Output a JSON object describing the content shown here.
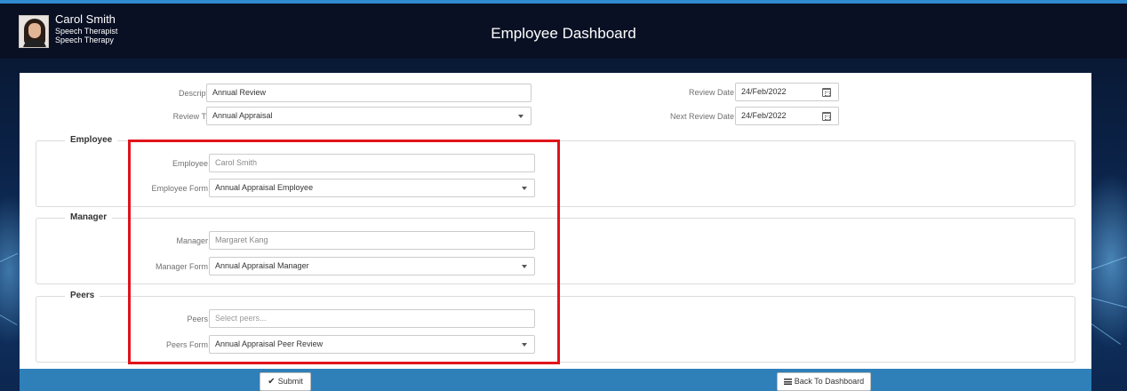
{
  "header": {
    "user": {
      "name": "Carol Smith",
      "role": "Speech Therapist",
      "department": "Speech Therapy"
    },
    "title": "Employee Dashboard"
  },
  "form": {
    "description": {
      "label": "Description *",
      "value": "Annual Review"
    },
    "review_type": {
      "label": "Review Type *",
      "value": "Annual Appraisal"
    },
    "review_date": {
      "label": "Review Date",
      "value": "24/Feb/2022"
    },
    "next_review_date": {
      "label": "Next Review Date",
      "value": "24/Feb/2022"
    },
    "employee_section": {
      "legend": "Employee",
      "employee": {
        "label": "Employee",
        "value": "Carol Smith"
      },
      "form": {
        "label": "Employee Form",
        "value": "Annual Appraisal Employee"
      }
    },
    "manager_section": {
      "legend": "Manager",
      "manager": {
        "label": "Manager",
        "value": "Margaret Kang"
      },
      "form": {
        "label": "Manager Form",
        "value": "Annual Appraisal Manager"
      }
    },
    "peers_section": {
      "legend": "Peers",
      "peers": {
        "label": "Peers",
        "placeholder": "Select peers..."
      },
      "form": {
        "label": "Peers Form",
        "value": "Annual Appraisal Peer Review"
      }
    }
  },
  "footer": {
    "submit_label": "Submit",
    "back_label": "Back To Dashboard"
  },
  "icons": {
    "submit": "check-icon",
    "back": "list-icon",
    "date": "calendar-icon"
  },
  "colors": {
    "header_bg": "#0a1024",
    "footer_bar": "#2f7fb9",
    "highlight_border": "#e0141b"
  }
}
